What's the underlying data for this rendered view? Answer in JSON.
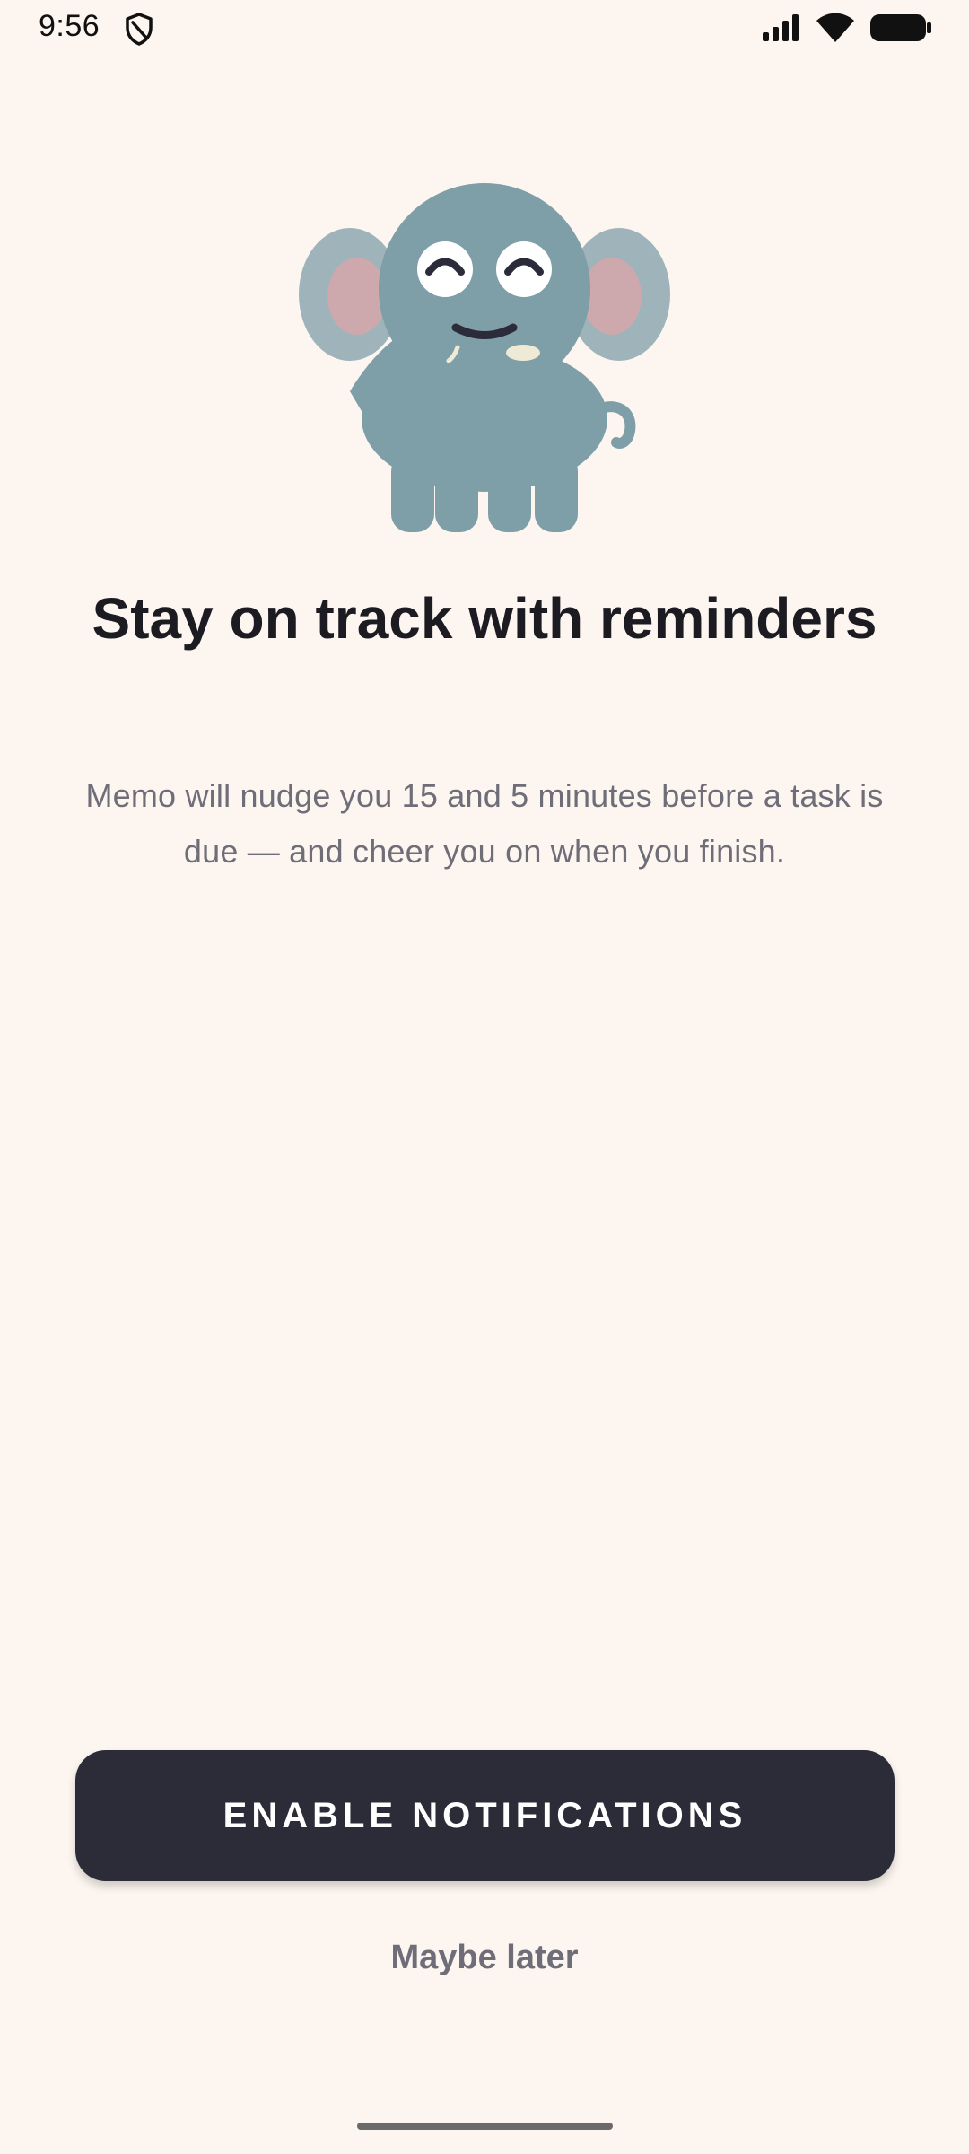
{
  "status_bar": {
    "time": "9:56",
    "icons": [
      "shield-icon",
      "signal-icon",
      "wifi-icon",
      "battery-icon"
    ]
  },
  "hero": {
    "illustration": "elephant-illustration",
    "colors": {
      "body": "#7E9EA8",
      "ear_outer": "#9FB4BA",
      "ear_inner": "#CDA8AD",
      "eye_white": "#FFFFFF",
      "eye_line": "#2B2B3A",
      "tusk": "#EEEAD6"
    }
  },
  "onboarding": {
    "title": "Stay on track with reminders",
    "description": "Memo will nudge you 15 and 5 minutes before a task is due — and cheer you on when you finish."
  },
  "actions": {
    "primary_label": "ENABLE NOTIFICATIONS",
    "secondary_label": "Maybe later"
  },
  "theme": {
    "background": "#FDF6F0",
    "button_bg": "#2C2B38",
    "title_color": "#1C1B22",
    "muted_text": "#6E6D78"
  }
}
